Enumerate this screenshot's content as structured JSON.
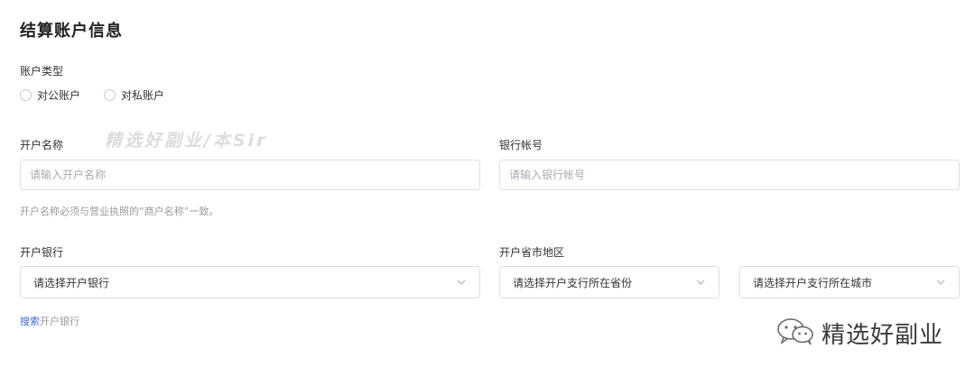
{
  "section_title": "结算账户信息",
  "account_type": {
    "label": "账户类型",
    "options": [
      "对公账户",
      "对私账户"
    ]
  },
  "account_name": {
    "label": "开户名称",
    "placeholder": "请输入开户名称",
    "hint": "开户名称必须与营业执照的“商户名称”一致。"
  },
  "bank_account": {
    "label": "银行帐号",
    "placeholder": "请输入银行帐号"
  },
  "bank": {
    "label": "开户银行",
    "placeholder": "请选择开户银行",
    "search_link": "搜索",
    "search_rest": "开户银行"
  },
  "region": {
    "label": "开户省市地区",
    "province_placeholder": "请选择开户支行所在省份",
    "city_placeholder": "请选择开户支行所在城市"
  },
  "watermark": {
    "top_text": "精选好副业/本Sir",
    "brand_text": "精选好副业"
  },
  "colors": {
    "link": "#3d6bd8",
    "border": "#dcdfe6",
    "hint": "#9a9a9a"
  },
  "icons": [
    "radio-icon",
    "chevron-down-icon",
    "wechat-icon"
  ]
}
